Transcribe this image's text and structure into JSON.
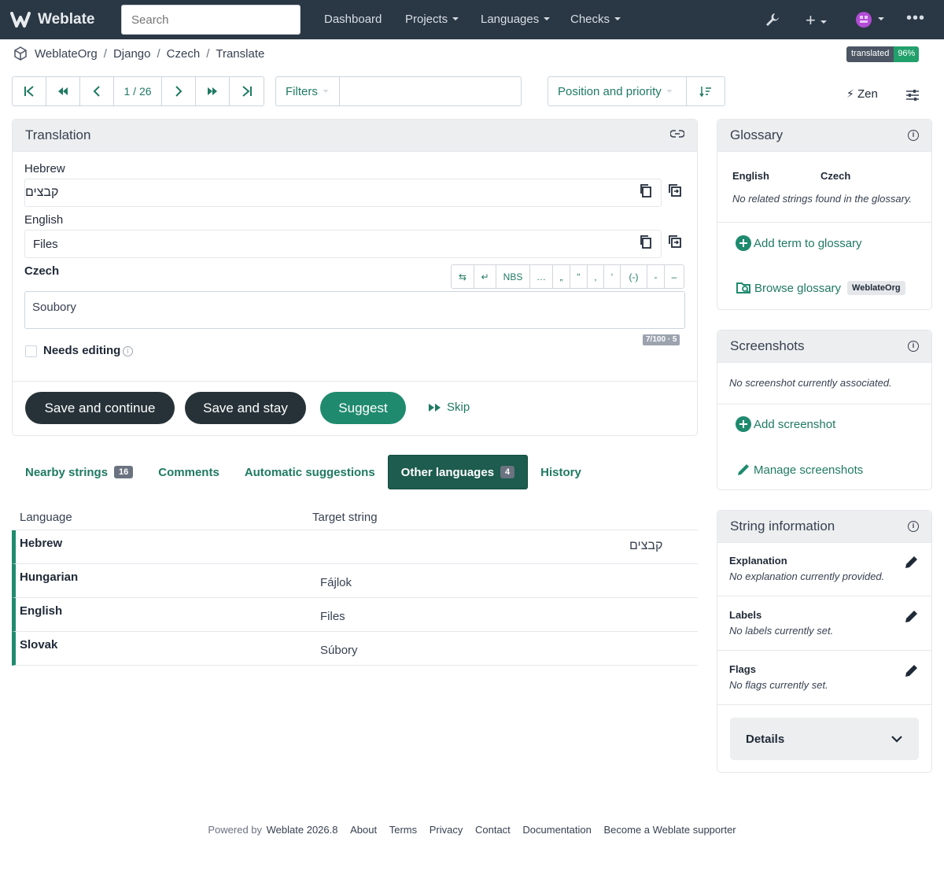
{
  "nav": {
    "brand": "Weblate",
    "search_placeholder": "Search",
    "items": [
      "Dashboard",
      "Projects",
      "Languages",
      "Checks"
    ]
  },
  "breadcrumb": [
    "WeblateOrg",
    "Django",
    "Czech",
    "Translate"
  ],
  "status_badge": {
    "label": "translated",
    "value": "96%"
  },
  "pager": {
    "position": "1 / 26"
  },
  "toolbar": {
    "filters": "Filters",
    "sort": "Position and priority",
    "zen": "Zen"
  },
  "translation": {
    "title": "Translation",
    "hebrew_label": "Hebrew",
    "hebrew_value": "קבצים",
    "english_label": "English",
    "english_value": "Files",
    "czech_label": "Czech",
    "czech_value": "Soubory",
    "counter": "7/100 · 5",
    "needs_editing": "Needs editing",
    "special_chars": [
      "⇆",
      "↵",
      "NBS",
      "…",
      "„",
      "“",
      "‚",
      "‘",
      "(-)",
      "-",
      "–"
    ]
  },
  "actions": {
    "save_continue": "Save and continue",
    "save_stay": "Save and stay",
    "suggest": "Suggest",
    "skip": "Skip"
  },
  "tabs": [
    {
      "label": "Nearby strings",
      "count": "16"
    },
    {
      "label": "Comments",
      "count": ""
    },
    {
      "label": "Automatic suggestions",
      "count": ""
    },
    {
      "label": "Other languages",
      "count": "4"
    },
    {
      "label": "History",
      "count": ""
    }
  ],
  "other_languages": {
    "headers": [
      "Language",
      "Target string"
    ],
    "rows": [
      {
        "language": "Hebrew",
        "target": "קבצים"
      },
      {
        "language": "Hungarian",
        "target": "Fájlok"
      },
      {
        "language": "English",
        "target": "Files"
      },
      {
        "language": "Slovak",
        "target": "Súbory"
      }
    ]
  },
  "glossary": {
    "title": "Glossary",
    "col_source": "English",
    "col_target": "Czech",
    "empty": "No related strings found in the glossary.",
    "add": "Add term to glossary",
    "browse": "Browse glossary",
    "browse_badge": "WeblateOrg"
  },
  "screenshots": {
    "title": "Screenshots",
    "empty": "No screenshot currently associated.",
    "add": "Add screenshot",
    "manage": "Manage screenshots"
  },
  "string_info": {
    "title": "String information",
    "explanation_label": "Explanation",
    "explanation_value": "No explanation currently provided.",
    "labels_label": "Labels",
    "labels_value": "No labels currently set.",
    "flags_label": "Flags",
    "flags_value": "No flags currently set.",
    "details": "Details"
  },
  "footer": {
    "powered": "Powered by",
    "version": "Weblate 2026.8",
    "links": [
      "About",
      "Terms",
      "Privacy",
      "Contact",
      "Documentation",
      "Become a Weblate supporter"
    ]
  },
  "colors": {
    "nav_bg": "#2a3744",
    "accent": "#1f8a6e",
    "dark_button": "#263238"
  }
}
